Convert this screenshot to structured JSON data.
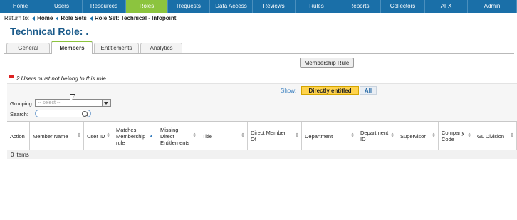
{
  "topnav": {
    "items": [
      {
        "label": "Home"
      },
      {
        "label": "Users"
      },
      {
        "label": "Resources"
      },
      {
        "label": "Roles"
      },
      {
        "label": "Requests"
      },
      {
        "label": "Data Access"
      },
      {
        "label": "Reviews"
      },
      {
        "label": "Rules"
      },
      {
        "label": "Reports"
      },
      {
        "label": "Collectors"
      },
      {
        "label": "AFX"
      },
      {
        "label": "Admin"
      }
    ],
    "active_index": 3,
    "bg_color": "#1a6fa8",
    "active_color": "#8cc43e"
  },
  "breadcrumb": {
    "prefix": "Return to:",
    "items": [
      {
        "label": "Home"
      },
      {
        "label": "Role Sets"
      },
      {
        "label": "Role Set: Technical - Infopoint"
      }
    ]
  },
  "page": {
    "title": "Technical Role: ."
  },
  "tabs": [
    {
      "label": "General"
    },
    {
      "label": "Members"
    },
    {
      "label": "Entitlements"
    },
    {
      "label": "Analytics"
    }
  ],
  "active_tab": "Members",
  "toolbar": {
    "membership_rule_label": "Membership Rule"
  },
  "warning": {
    "text": "2 Users must not belong to this role",
    "icon": "flag-icon"
  },
  "filter": {
    "show_label": "Show:",
    "options": [
      {
        "label": "Directly entitled",
        "selected": true
      },
      {
        "label": "All",
        "selected": false
      }
    ],
    "grouping_label": "Grouping:",
    "grouping_placeholder": "-- select --",
    "search_label": "Search:",
    "search_value": ""
  },
  "table": {
    "columns": [
      {
        "label": "Action"
      },
      {
        "label": "Member Name"
      },
      {
        "label": "User ID"
      },
      {
        "label": "Matches Membership rule"
      },
      {
        "label": "Missing Direct Entitlements"
      },
      {
        "label": "Title"
      },
      {
        "label": "Direct Member Of"
      },
      {
        "label": "Department"
      },
      {
        "label": "Department ID"
      },
      {
        "label": "Supervisor"
      },
      {
        "label": "Company Code"
      },
      {
        "label": "GL Division"
      }
    ],
    "rows": [],
    "items_text": "0 items"
  }
}
